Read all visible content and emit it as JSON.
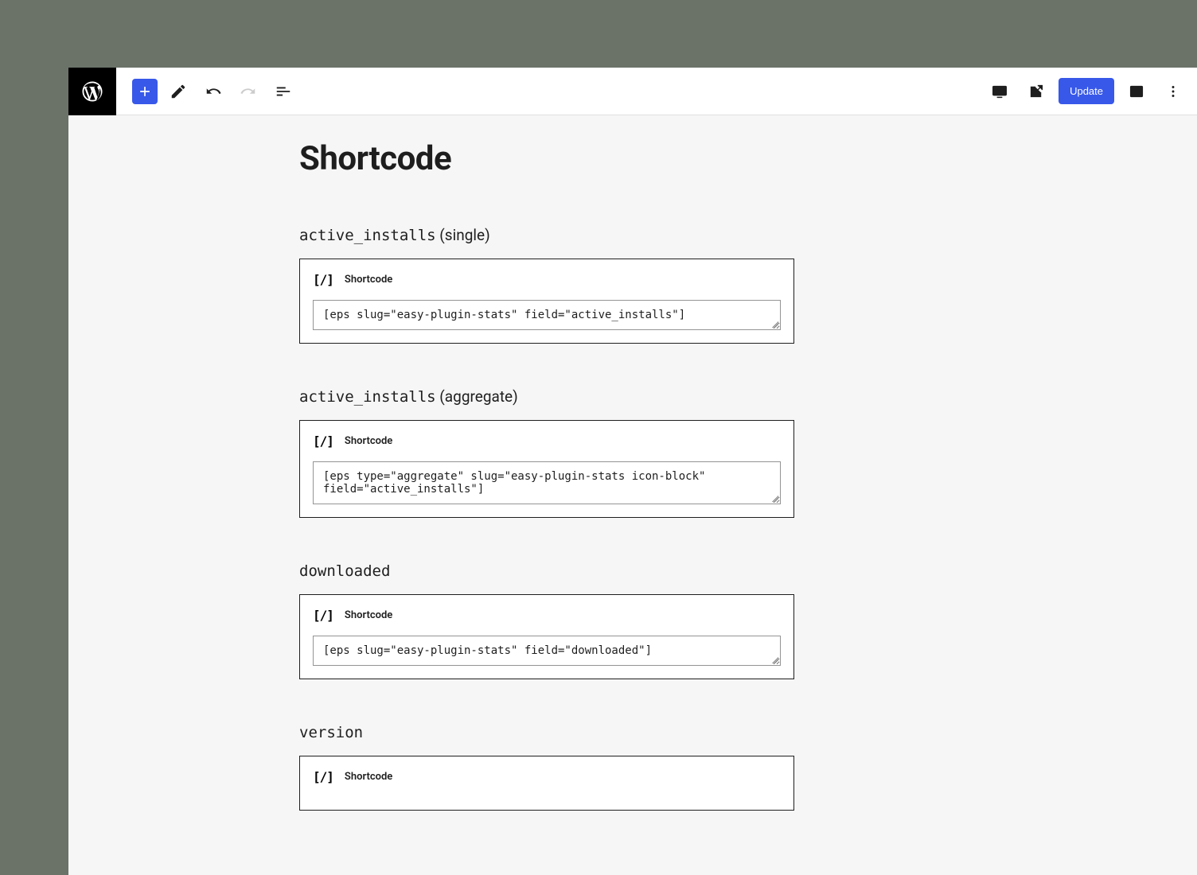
{
  "toolbar": {
    "update_label": "Update"
  },
  "page": {
    "title": "Shortcode"
  },
  "blocks": [
    {
      "heading_mono": "active_installs",
      "heading_suffix": " (single)",
      "label": "Shortcode",
      "code": "[eps slug=\"easy-plugin-stats\" field=\"active_installs\"]"
    },
    {
      "heading_mono": "active_installs",
      "heading_suffix": " (aggregate)",
      "label": "Shortcode",
      "code": "[eps type=\"aggregate\" slug=\"easy-plugin-stats icon-block\" field=\"active_installs\"]"
    },
    {
      "heading_mono": "downloaded",
      "heading_suffix": "",
      "label": "Shortcode",
      "code": "[eps slug=\"easy-plugin-stats\" field=\"downloaded\"]"
    },
    {
      "heading_mono": "version",
      "heading_suffix": "",
      "label": "Shortcode",
      "code": ""
    }
  ]
}
